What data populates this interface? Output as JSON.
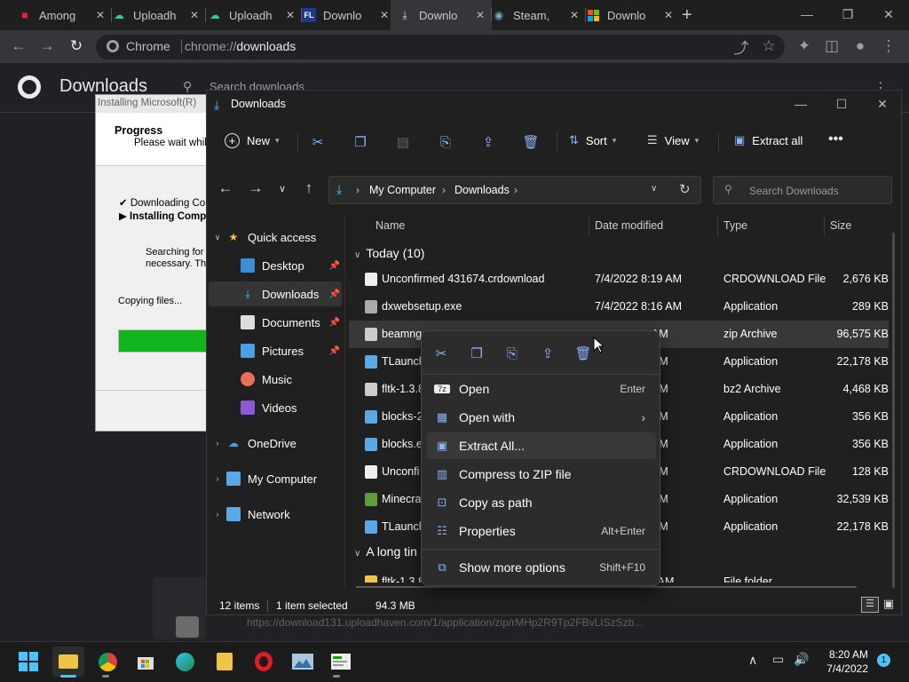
{
  "browser": {
    "tabs": [
      {
        "title": "Among",
        "icon": "among-us-icon"
      },
      {
        "title": "Uploadh",
        "icon": "uploadhaven-icon"
      },
      {
        "title": "Uploadh",
        "icon": "uploadhaven-icon"
      },
      {
        "title": "Downlo",
        "icon": "fl-icon"
      },
      {
        "title": "Downlo",
        "icon": "download-icon"
      },
      {
        "title": "Steam, ",
        "icon": "steam-icon"
      },
      {
        "title": "Downlo",
        "icon": "microsoft-icon"
      }
    ],
    "omnibox_site": "Chrome",
    "url_scheme": "chrome://",
    "url_host": "downloads"
  },
  "downloads_page": {
    "title": "Downloads",
    "search_placeholder": "Search downloads",
    "status_url": "https://download131.uploadhaven.com/1/application/zip/rMHp2R9Tp2FBvLISzSzb..."
  },
  "installer": {
    "title": "Installing Microsoft(R)",
    "heading": "Progress",
    "subheading": "Please wait while",
    "step1": "Downloading Com",
    "step2": "Installing Comp",
    "info1": "Searching for u",
    "info2": "necessary. Thi",
    "copying": "Copying files..."
  },
  "explorer": {
    "title": "Downloads",
    "toolbar": {
      "new": "New",
      "sort": "Sort",
      "view": "View",
      "extract_all": "Extract all"
    },
    "breadcrumb": [
      "My Computer",
      "Downloads"
    ],
    "search_placeholder": "Search Downloads",
    "nav": {
      "quick_access": "Quick access",
      "desktop": "Desktop",
      "downloads": "Downloads",
      "documents": "Documents",
      "pictures": "Pictures",
      "music": "Music",
      "videos": "Videos",
      "onedrive": "OneDrive",
      "my_computer": "My Computer",
      "network": "Network"
    },
    "columns": {
      "name": "Name",
      "date": "Date modified",
      "type": "Type",
      "size": "Size"
    },
    "group_today": "Today (10)",
    "group_long": "A long tin",
    "rows": [
      {
        "name": "Unconfirmed 431674.crdownload",
        "date": "7/4/2022 8:19 AM",
        "type": "CRDOWNLOAD File",
        "size": "2,676 KB"
      },
      {
        "name": "dxwebsetup.exe",
        "date": "7/4/2022 8:16 AM",
        "type": "Application",
        "size": "289 KB"
      },
      {
        "name": "beamng",
        "date": "AM",
        "type": "zip Archive",
        "size": "96,575 KB"
      },
      {
        "name": "TLaunch",
        "date": "AM",
        "type": "Application",
        "size": "22,178 KB"
      },
      {
        "name": "fltk-1.3.8",
        "date": "AM",
        "type": "bz2 Archive",
        "size": "4,468 KB"
      },
      {
        "name": "blocks-2",
        "date": "AM",
        "type": "Application",
        "size": "356 KB"
      },
      {
        "name": "blocks.e",
        "date": "AM",
        "type": "Application",
        "size": "356 KB"
      },
      {
        "name": "Unconfi",
        "date": "AM",
        "type": "CRDOWNLOAD File",
        "size": "128 KB"
      },
      {
        "name": "Minecra",
        "date": "AM",
        "type": "Application",
        "size": "32,539 KB"
      },
      {
        "name": "TLaunch",
        "date": "AM",
        "type": "Application",
        "size": "22,178 KB"
      }
    ],
    "last_row": {
      "name": "fltk-1.3.8",
      "date": "12 AM",
      "type": "File folder"
    },
    "status": {
      "items": "12 items",
      "selected": "1 item selected",
      "size": "94.3 MB"
    }
  },
  "context_menu": {
    "items": [
      {
        "label": "Open",
        "shortcut": "Enter",
        "icon": "open-icon"
      },
      {
        "label": "Open with",
        "shortcut": "",
        "icon": "open-with-icon"
      },
      {
        "label": "Extract All...",
        "shortcut": "",
        "icon": "extract-icon"
      },
      {
        "label": "Compress to ZIP file",
        "shortcut": "",
        "icon": "zip-icon"
      },
      {
        "label": "Copy as path",
        "shortcut": "",
        "icon": "copy-path-icon"
      },
      {
        "label": "Properties",
        "shortcut": "Alt+Enter",
        "icon": "properties-icon"
      },
      {
        "label": "Show more options",
        "shortcut": "Shift+F10",
        "icon": "more-options-icon"
      }
    ]
  },
  "taskbar": {
    "time": "8:20 AM",
    "date": "7/4/2022",
    "notifications": "1"
  },
  "colors": {
    "accent": "#4cc2ff",
    "bg": "#202020",
    "chrome": "#35363a",
    "folder": "#f0c445",
    "green": "#13a10e"
  }
}
